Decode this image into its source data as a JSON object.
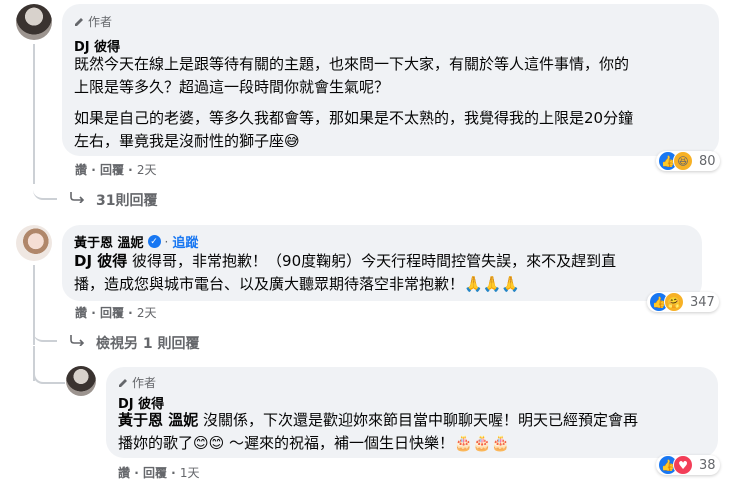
{
  "comment1": {
    "author_tag": "作者",
    "name": "DJ 彼得",
    "lines": [
      "既然今天在線上是跟等待有關的主題，也來問一下大家，有關於等人這件事情，你的",
      "上限是等多久？超過這一段時間你就會生氣呢？",
      "如果是自己的老婆，等多久我都會等，那如果是不太熟的，我覺得我的上限是20分鐘",
      "左右，畢竟我是沒耐性的獅子座😅"
    ],
    "actions": {
      "like": "讚",
      "reply": "回覆",
      "time": "2天"
    },
    "reaction_count": "80",
    "reaction_icons": [
      "like-icon",
      "haha-icon"
    ],
    "replies_link": "31則回覆"
  },
  "comment2": {
    "name": "黃于恩 溫妮",
    "verified_icon": "verified-badge-icon",
    "follow": "追蹤",
    "mention": "DJ 彼得",
    "lines": [
      " 彼得哥，非常抱歉！（90度鞠躬）今天行程時間控管失誤，來不及趕到直",
      "播，造成您與城市電台、以及廣大聽眾期待落空非常抱歉！🙏🙏🙏"
    ],
    "actions": {
      "like": "讚",
      "reply": "回覆",
      "time": "2天"
    },
    "reaction_count": "347",
    "reaction_icons": [
      "like-icon",
      "care-icon"
    ],
    "view_more": "檢視另 1 則回覆"
  },
  "comment3": {
    "author_tag": "作者",
    "name": "DJ 彼得",
    "mention": "黃于恩 溫妮",
    "lines": [
      " 沒關係，下次還是歡迎妳來節目當中聊聊天喔！明天已經預定會再",
      "播妳的歌了😊😊 ～遲來的祝福，補一個生日快樂！🎂🎂🎂"
    ],
    "actions": {
      "like": "讚",
      "reply": "回覆",
      "time": "1天"
    },
    "reaction_count": "38",
    "reaction_icons": [
      "like-icon",
      "love-icon"
    ]
  },
  "colors": {
    "bubble": "#f0f2f5",
    "link": "#1877f2",
    "meta": "#65676b",
    "like": "#1877f2",
    "love": "#f33e58",
    "haha": "#f7b125"
  }
}
